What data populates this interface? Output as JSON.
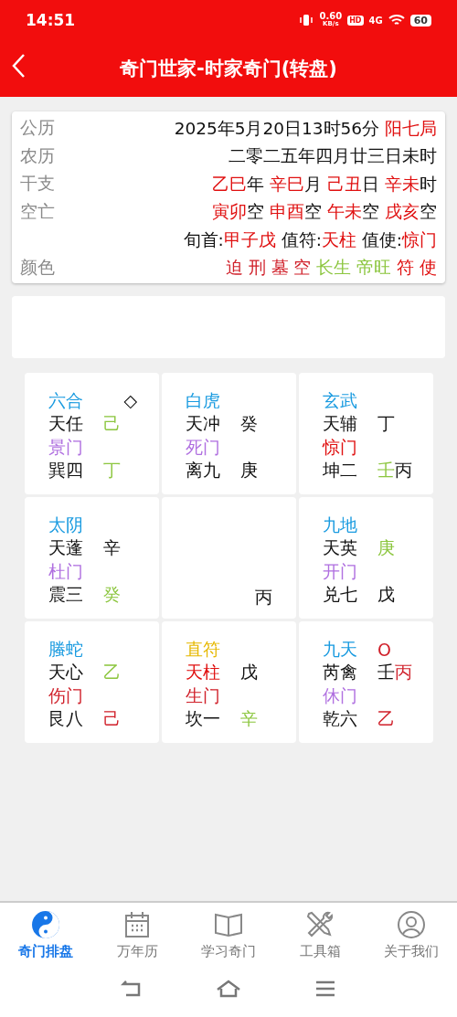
{
  "status_bar": {
    "time": "14:51",
    "speed": "0.60",
    "speed_unit": "KB/s",
    "hd": "HD",
    "network": "4G",
    "battery": "60"
  },
  "header": {
    "title": "奇门世家-时家奇门(转盘)"
  },
  "info": [
    {
      "label": "公历",
      "parts": [
        {
          "text": "2025年5月20日13时56分 ",
          "color": "#111111"
        },
        {
          "text": "阳七局",
          "color": "#e01010"
        }
      ]
    },
    {
      "label": "农历",
      "parts": [
        {
          "text": "二零二五年四月廿三日未时",
          "color": "#111111"
        }
      ]
    },
    {
      "label": "干支",
      "parts": [
        {
          "text": "乙巳",
          "color": "#e01010"
        },
        {
          "text": "年 ",
          "color": "#111111"
        },
        {
          "text": "辛巳",
          "color": "#e01010"
        },
        {
          "text": "月 ",
          "color": "#111111"
        },
        {
          "text": "己丑",
          "color": "#e01010"
        },
        {
          "text": "日 ",
          "color": "#111111"
        },
        {
          "text": "辛未",
          "color": "#e01010"
        },
        {
          "text": "时",
          "color": "#111111"
        }
      ]
    },
    {
      "label": "空亡",
      "parts": [
        {
          "text": "寅卯",
          "color": "#e01010"
        },
        {
          "text": "空 ",
          "color": "#111111"
        },
        {
          "text": "申酉",
          "color": "#e01010"
        },
        {
          "text": "空 ",
          "color": "#111111"
        },
        {
          "text": "午未",
          "color": "#e01010"
        },
        {
          "text": "空 ",
          "color": "#111111"
        },
        {
          "text": "戌亥",
          "color": "#e01010"
        },
        {
          "text": "空",
          "color": "#111111"
        }
      ]
    },
    {
      "parts": [
        {
          "text": "旬首:",
          "color": "#111111"
        },
        {
          "text": "甲子戊",
          "color": "#e01010"
        },
        {
          "text": "  值符:",
          "color": "#111111"
        },
        {
          "text": "天柱",
          "color": "#e01010"
        },
        {
          "text": "   值使:",
          "color": "#111111"
        },
        {
          "text": "惊门",
          "color": "#e01010"
        }
      ]
    },
    {
      "label": "颜色",
      "parts": [
        {
          "text": "迫 ",
          "color": "#d0202a"
        },
        {
          "text": "刑 ",
          "color": "#d0202a"
        },
        {
          "text": "墓 ",
          "color": "#d0202a"
        },
        {
          "text": "空 ",
          "color": "#d0202a"
        },
        {
          "text": "长生 ",
          "color": "#8cc63f"
        },
        {
          "text": "帝旺 ",
          "color": "#8cc63f"
        },
        {
          "text": "符 ",
          "color": "#e01010"
        },
        {
          "text": "使",
          "color": "#e01010"
        }
      ]
    }
  ],
  "palaces": [
    {
      "kind": "normal",
      "marker": "◇",
      "rows": [
        [
          {
            "text": "六合",
            "color": "#1a9be0"
          }
        ],
        [
          {
            "text": "天任",
            "color": "#111111"
          },
          {
            "text": "己",
            "color": "#8cc63f"
          }
        ],
        [
          {
            "text": "景门",
            "color": "#b070e0"
          }
        ],
        [
          {
            "text": "巽四",
            "color": "#111111"
          },
          {
            "text": "丁",
            "color": "#8cc63f"
          }
        ]
      ]
    },
    {
      "kind": "normal",
      "rows": [
        [
          {
            "text": "白虎",
            "color": "#1a9be0"
          }
        ],
        [
          {
            "text": "天冲",
            "color": "#111111"
          },
          {
            "text": "癸",
            "color": "#111111"
          }
        ],
        [
          {
            "text": "死门",
            "color": "#b070e0"
          }
        ],
        [
          {
            "text": "离九",
            "color": "#111111"
          },
          {
            "text": "庚",
            "color": "#111111"
          }
        ]
      ]
    },
    {
      "kind": "normal",
      "rows": [
        [
          {
            "text": "玄武",
            "color": "#1a9be0"
          }
        ],
        [
          {
            "text": "天辅",
            "color": "#111111"
          },
          {
            "text": "丁",
            "color": "#111111"
          }
        ],
        [
          {
            "text": "惊门",
            "color": "#e01010"
          }
        ],
        [
          {
            "text": "坤二",
            "color": "#111111"
          },
          {
            "text": "壬",
            "color": "#8cc63f"
          },
          {
            "text": "丙",
            "color": "#111111"
          }
        ]
      ]
    },
    {
      "kind": "normal",
      "rows": [
        [
          {
            "text": "太阴",
            "color": "#1a9be0"
          }
        ],
        [
          {
            "text": "天蓬",
            "color": "#111111"
          },
          {
            "text": "辛",
            "color": "#111111"
          }
        ],
        [
          {
            "text": "杜门",
            "color": "#b070e0"
          }
        ],
        [
          {
            "text": "震三",
            "color": "#111111"
          },
          {
            "text": "癸",
            "color": "#8cc63f"
          }
        ]
      ]
    },
    {
      "kind": "center",
      "rows": [
        [
          {
            "text": "丙",
            "color": "#111111"
          }
        ]
      ]
    },
    {
      "kind": "normal",
      "rows": [
        [
          {
            "text": "九地",
            "color": "#1a9be0"
          }
        ],
        [
          {
            "text": "天英",
            "color": "#111111"
          },
          {
            "text": "庚",
            "color": "#8cc63f"
          }
        ],
        [
          {
            "text": "开门",
            "color": "#b070e0"
          }
        ],
        [
          {
            "text": "兑七",
            "color": "#111111"
          },
          {
            "text": "戊",
            "color": "#111111"
          }
        ]
      ]
    },
    {
      "kind": "normal",
      "rows": [
        [
          {
            "text": "螣蛇",
            "color": "#1a9be0"
          }
        ],
        [
          {
            "text": "天心",
            "color": "#111111"
          },
          {
            "text": "乙",
            "color": "#8cc63f"
          }
        ],
        [
          {
            "text": "伤门",
            "color": "#d0202a"
          }
        ],
        [
          {
            "text": "艮八",
            "color": "#111111"
          },
          {
            "text": "己",
            "color": "#d0202a"
          }
        ]
      ]
    },
    {
      "kind": "normal",
      "rows": [
        [
          {
            "text": "直符",
            "color": "#e6b800"
          }
        ],
        [
          {
            "text": "天柱",
            "color": "#e01010"
          },
          {
            "text": "戊",
            "color": "#111111"
          }
        ],
        [
          {
            "text": "生门",
            "color": "#d0202a"
          }
        ],
        [
          {
            "text": "坎一",
            "color": "#111111"
          },
          {
            "text": "辛",
            "color": "#8cc63f"
          }
        ]
      ]
    },
    {
      "kind": "normal",
      "rows": [
        [
          {
            "text": "九天",
            "color": "#1a9be0"
          },
          {
            "text": "O",
            "color": "#d0202a"
          }
        ],
        [
          {
            "text": "芮禽",
            "color": "#111111"
          },
          {
            "text": "壬",
            "color": "#111111"
          },
          {
            "text": "丙",
            "color": "#d0202a"
          }
        ],
        [
          {
            "text": "休门",
            "color": "#b070e0"
          }
        ],
        [
          {
            "text": "乾六",
            "color": "#111111"
          },
          {
            "text": "乙",
            "color": "#d0202a"
          }
        ]
      ]
    }
  ],
  "tabs": [
    {
      "label": "奇门排盘",
      "kind": "yinyang",
      "selected": true
    },
    {
      "label": "万年历",
      "kind": "calendar",
      "selected": false
    },
    {
      "label": "学习奇门",
      "kind": "book",
      "selected": false
    },
    {
      "label": "工具箱",
      "kind": "tools",
      "selected": false
    },
    {
      "label": "关于我们",
      "kind": "person",
      "selected": false
    }
  ]
}
